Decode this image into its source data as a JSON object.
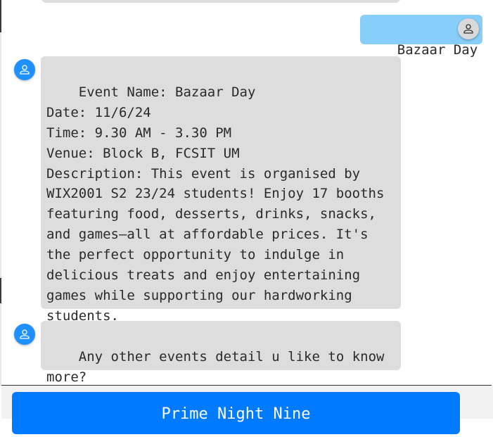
{
  "chat": {
    "messages": [
      {
        "sender": "user",
        "text": "Bazaar Day"
      },
      {
        "sender": "bot",
        "text": "Event Name: Bazaar Day\nDate: 11/6/24\nTime: 9.30 AM - 3.30 PM\nVenue: Block B, FCSIT UM\nDescription: This event is organised by\nWIX2001 S2 23/24 students! Enjoy 17 booths\nfeaturing food, desserts, drinks, snacks,\nand games—all at affordable prices. It's\nthe perfect opportunity to indulge in\ndelicious treats and enjoy entertaining\ngames while supporting our hardworking\nstudents."
      },
      {
        "sender": "bot",
        "text": "Any other events detail u like to know\nmore?"
      }
    ]
  },
  "options": {
    "first_option_label": "Prime Night Nine"
  },
  "colors": {
    "user_bubble": "#87cefa",
    "bot_bubble": "#dddddd",
    "bot_avatar": "#1e90ff",
    "option_button": "#007bff"
  },
  "icons": {
    "user_avatar": "person-icon",
    "bot_avatar": "person-icon"
  }
}
